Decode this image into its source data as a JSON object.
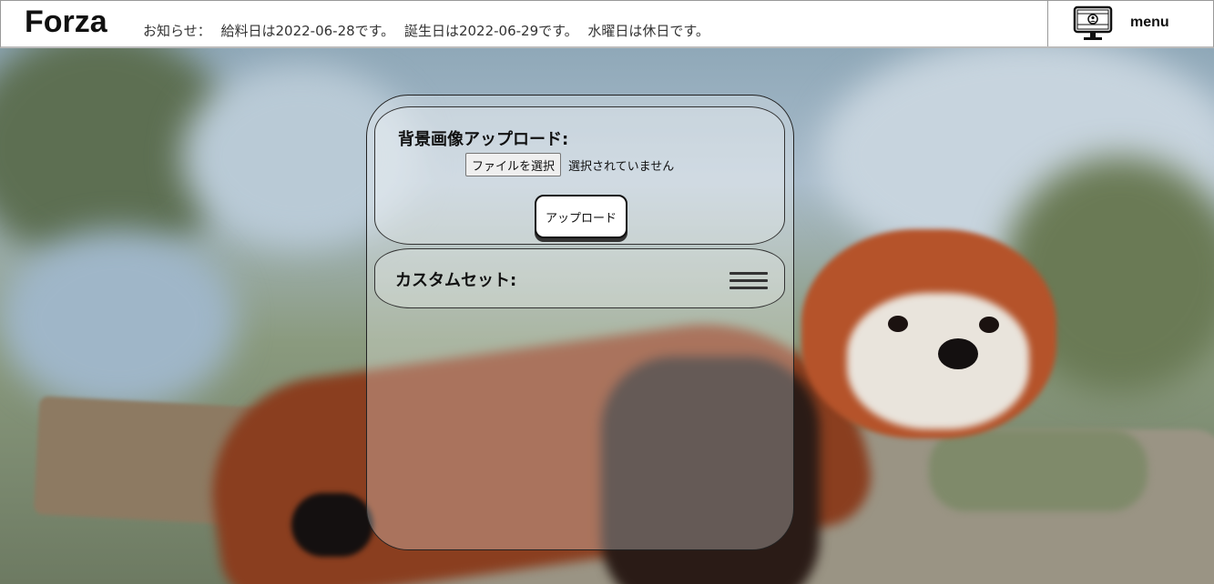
{
  "header": {
    "logo": "Forza",
    "notice_label": "お知らせ：",
    "notices": [
      "給料日は2022-06-28です。",
      "誕生日は2022-06-29です。",
      "水曜日は休日です。"
    ],
    "menu_label": "menu"
  },
  "upload": {
    "title": "背景画像アップロード:",
    "file_button": "ファイルを選択",
    "file_status": "選択されていません",
    "upload_button": "アップロード"
  },
  "custom_set": {
    "title": "カスタムセット:"
  },
  "colors": {
    "header_bg": "#ffffff",
    "text": "#111111",
    "panel_border": "#222222"
  }
}
